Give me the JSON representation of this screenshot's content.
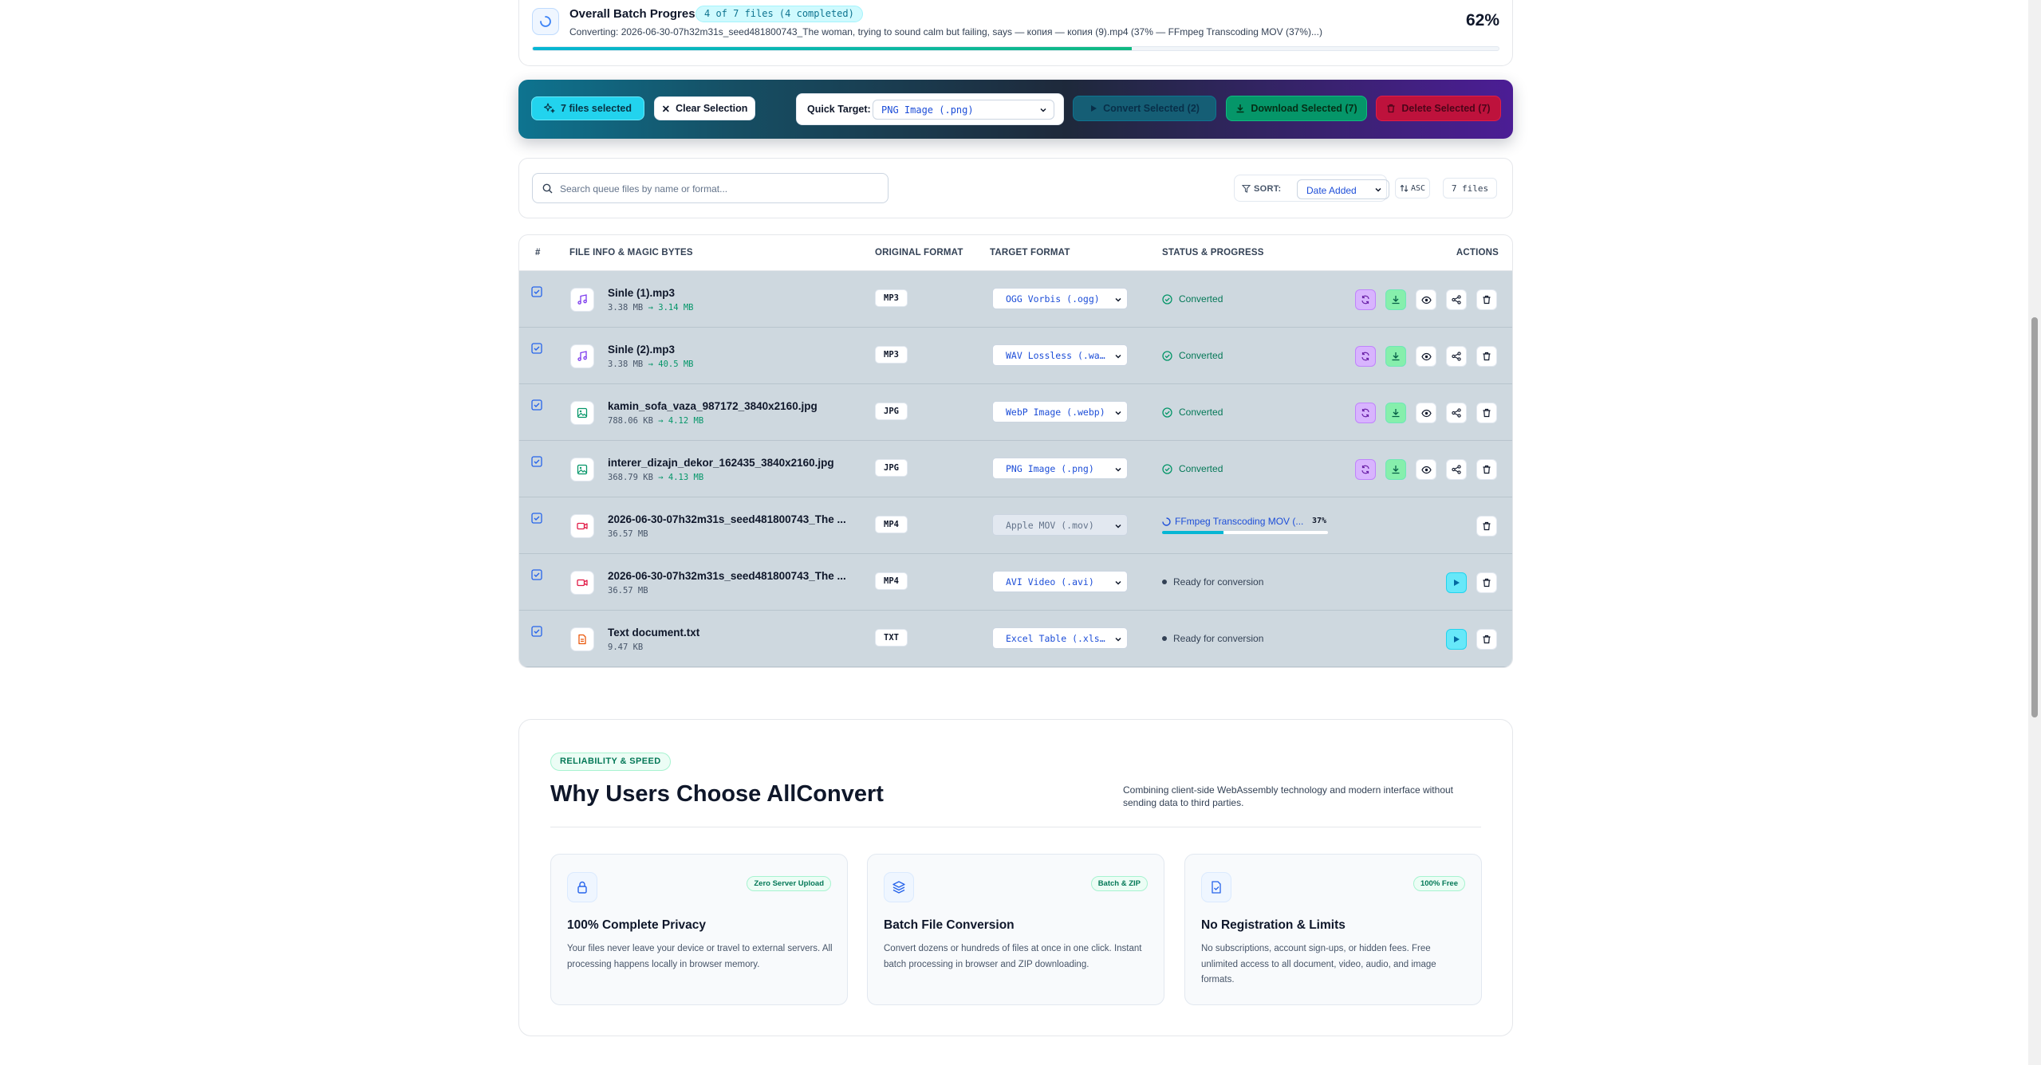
{
  "batch": {
    "title": "Overall Batch Progress",
    "badge": "4 of 7 files (4 completed)",
    "detail": "Converting: 2026-06-30-07h32m31s_seed481800743_The woman, trying to sound calm but failing, says — копия — копия (9).mp4 (37% — FFmpeg Transcoding MOV (37%)...)",
    "percent_label": "62%",
    "progress": 0.62
  },
  "selection": {
    "count_label": "7 files selected",
    "clear_label": "Clear Selection",
    "quick_target_label": "Quick Target:",
    "quick_target_value": "PNG Image (.png)",
    "convert_label": "Convert Selected (2)",
    "download_label": "Download Selected (7)",
    "delete_label": "Delete Selected (7)"
  },
  "toolbar": {
    "search_placeholder": "Search queue files by name or format...",
    "sort_label": "SORT:",
    "sort_value": "Date Added",
    "order_label": "ASC",
    "file_count": "7 files"
  },
  "table": {
    "headers": {
      "index": "#",
      "file": "FILE INFO & MAGIC BYTES",
      "original": "ORIGINAL FORMAT",
      "target": "TARGET FORMAT",
      "status": "STATUS & PROGRESS",
      "actions": "ACTIONS"
    },
    "rows": [
      {
        "name": "Sinle (1).mp3",
        "size": "3.38 MB",
        "arrow": "→",
        "output": "3.14 MB",
        "original": "MP3",
        "target": "OGG Vorbis (.ogg)",
        "status": "Converted",
        "kind": "audio-icon",
        "state": "done"
      },
      {
        "name": "Sinle (2).mp3",
        "size": "3.38 MB",
        "arrow": "→",
        "output": "40.5 MB",
        "original": "MP3",
        "target": "WAV Lossless (.wa…",
        "status": "Converted",
        "kind": "audio-icon",
        "state": "done"
      },
      {
        "name": "kamin_sofa_vaza_987172_3840x2160.jpg",
        "size": "788.06 KB",
        "arrow": "→",
        "output": "4.12 MB",
        "original": "JPG",
        "target": "WebP Image (.webp)",
        "status": "Converted",
        "kind": "image-icon",
        "state": "done"
      },
      {
        "name": "interer_dizajn_dekor_162435_3840x2160.jpg",
        "size": "368.79 KB",
        "arrow": "→",
        "output": "4.13 MB",
        "original": "JPG",
        "target": "PNG Image (.png)",
        "status": "Converted",
        "kind": "image-icon",
        "state": "done"
      },
      {
        "name": "2026-06-30-07h32m31s_seed481800743_The ...",
        "size": "36.57 MB",
        "arrow": "",
        "output": "",
        "original": "MP4",
        "target": "Apple MOV (.mov)",
        "status": "FFmpeg Transcoding MOV (...",
        "percent_label": "37%",
        "progress": 0.37,
        "kind": "video-icon",
        "state": "progress"
      },
      {
        "name": "2026-06-30-07h32m31s_seed481800743_The ...",
        "size": "36.57 MB",
        "arrow": "",
        "output": "",
        "original": "MP4",
        "target": "AVI Video (.avi)",
        "status": "Ready for conversion",
        "kind": "video-icon",
        "state": "ready"
      },
      {
        "name": "Text document.txt",
        "size": "9.47 KB",
        "arrow": "",
        "output": "",
        "original": "TXT",
        "target": "Excel Table (.xls…",
        "status": "Ready for conversion",
        "kind": "document-icon",
        "state": "ready"
      }
    ]
  },
  "why": {
    "badge": "RELIABILITY & SPEED",
    "title": "Why Users Choose AllConvert",
    "subtitle": "Combining client-side WebAssembly technology and modern interface without sending data to third parties.",
    "cards": [
      {
        "icon": "lock-icon",
        "tag": "Zero Server Upload",
        "title": "100% Complete Privacy",
        "desc": "Your files never leave your device or travel to external servers. All processing happens locally in browser memory."
      },
      {
        "icon": "layers-icon",
        "tag": "Batch & ZIP",
        "title": "Batch File Conversion",
        "desc": "Convert dozens or hundreds of files at once in one click. Instant batch processing in browser and ZIP downloading."
      },
      {
        "icon": "document-check-icon",
        "tag": "100% Free",
        "title": "No Registration & Limits",
        "desc": "No subscriptions, account sign-ups, or hidden fees. Free unlimited access to all document, video, audio, and image formats."
      }
    ]
  },
  "colors": {
    "accent": "#06b6d4",
    "success": "#10b981",
    "danger": "#e11d48",
    "row_selected": "#ced8df"
  }
}
